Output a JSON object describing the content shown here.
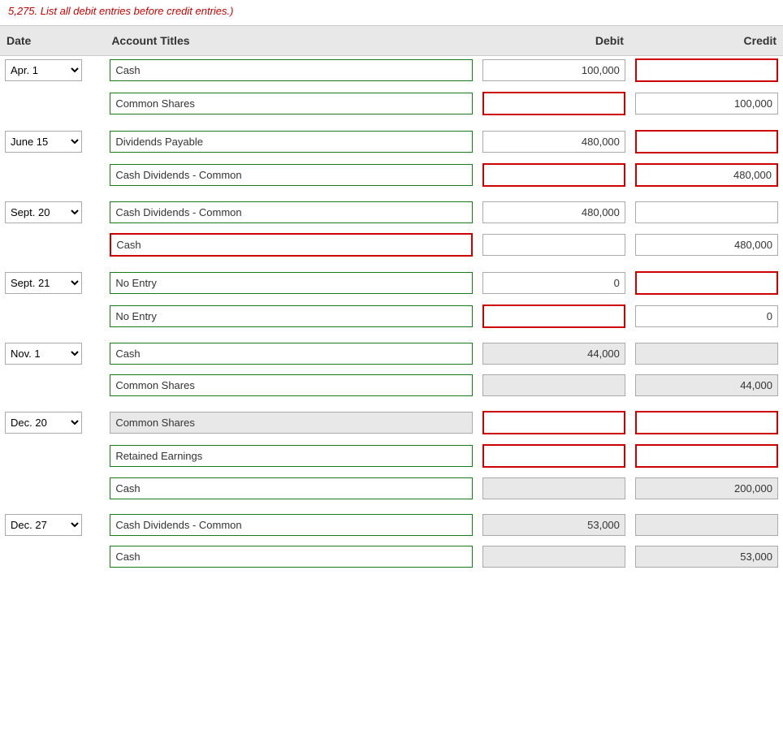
{
  "topNote": "5,275. List all debit entries before credit entries.)",
  "header": {
    "date": "Date",
    "accountTitles": "Account Titles",
    "debit": "Debit",
    "credit": "Credit"
  },
  "rows": [
    {
      "id": "row1",
      "date": "Apr. 1",
      "dateOptions": [
        "Apr. 1",
        "June 15",
        "Sept. 20",
        "Sept. 21",
        "Nov. 1",
        "Dec. 20",
        "Dec. 27"
      ],
      "entries": [
        {
          "account": "Cash",
          "accountStyle": "green-border",
          "debit": "100,000",
          "debitStyle": "normal",
          "credit": "",
          "creditStyle": "red-border"
        },
        {
          "account": "Common Shares",
          "accountStyle": "green-border",
          "debit": "",
          "debitStyle": "red-border",
          "credit": "100,000",
          "creditStyle": "normal"
        }
      ]
    },
    {
      "id": "row2",
      "date": "June 15",
      "dateOptions": [
        "Apr. 1",
        "June 15",
        "Sept. 20",
        "Sept. 21",
        "Nov. 1",
        "Dec. 20",
        "Dec. 27"
      ],
      "entries": [
        {
          "account": "Dividends Payable",
          "accountStyle": "green-border",
          "debit": "480,000",
          "debitStyle": "normal",
          "credit": "",
          "creditStyle": "red-border"
        },
        {
          "account": "Cash Dividends - Common",
          "accountStyle": "green-border",
          "debit": "",
          "debitStyle": "red-border",
          "credit": "480,000",
          "creditStyle": "red-border"
        }
      ]
    },
    {
      "id": "row3",
      "date": "Sept. 20",
      "dateOptions": [
        "Apr. 1",
        "June 15",
        "Sept. 20",
        "Sept. 21",
        "Nov. 1",
        "Dec. 20",
        "Dec. 27"
      ],
      "entries": [
        {
          "account": "Cash Dividends - Common",
          "accountStyle": "green-border",
          "debit": "480,000",
          "debitStyle": "normal",
          "credit": "",
          "creditStyle": "normal"
        },
        {
          "account": "Cash",
          "accountStyle": "red-border",
          "debit": "",
          "debitStyle": "normal",
          "credit": "480,000",
          "creditStyle": "normal"
        }
      ]
    },
    {
      "id": "row4",
      "date": "Sept. 21",
      "dateOptions": [
        "Apr. 1",
        "June 15",
        "Sept. 20",
        "Sept. 21",
        "Nov. 1",
        "Dec. 20",
        "Dec. 27"
      ],
      "entries": [
        {
          "account": "No Entry",
          "accountStyle": "green-border",
          "debit": "0",
          "debitStyle": "normal",
          "credit": "",
          "creditStyle": "red-border"
        },
        {
          "account": "No Entry",
          "accountStyle": "green-border",
          "debit": "",
          "debitStyle": "red-border",
          "credit": "0",
          "creditStyle": "normal"
        }
      ]
    },
    {
      "id": "row5",
      "date": "Nov. 1",
      "dateOptions": [
        "Apr. 1",
        "June 15",
        "Sept. 20",
        "Sept. 21",
        "Nov. 1",
        "Dec. 20",
        "Dec. 27"
      ],
      "entries": [
        {
          "account": "Cash",
          "accountStyle": "green-border",
          "debit": "44,000",
          "debitStyle": "green-fill",
          "credit": "",
          "creditStyle": "green-fill"
        },
        {
          "account": "Common Shares",
          "accountStyle": "green-border",
          "debit": "",
          "debitStyle": "green-fill",
          "credit": "44,000",
          "creditStyle": "green-fill"
        }
      ]
    },
    {
      "id": "row6",
      "date": "Dec. 20",
      "dateOptions": [
        "Apr. 1",
        "June 15",
        "Sept. 20",
        "Sept. 21",
        "Nov. 1",
        "Dec. 20",
        "Dec. 27"
      ],
      "entries": [
        {
          "account": "Common Shares",
          "accountStyle": "gray-bg",
          "debit": "",
          "debitStyle": "red-border",
          "credit": "",
          "creditStyle": "red-border"
        },
        {
          "account": "Retained Earnings",
          "accountStyle": "green-border",
          "debit": "",
          "debitStyle": "red-border",
          "credit": "",
          "creditStyle": "red-border"
        },
        {
          "account": "Cash",
          "accountStyle": "green-border",
          "debit": "",
          "debitStyle": "green-fill",
          "credit": "200,000",
          "creditStyle": "green-fill"
        }
      ]
    },
    {
      "id": "row7",
      "date": "Dec. 27",
      "dateOptions": [
        "Apr. 1",
        "June 15",
        "Sept. 20",
        "Sept. 21",
        "Nov. 1",
        "Dec. 20",
        "Dec. 27"
      ],
      "entries": [
        {
          "account": "Cash Dividends - Common",
          "accountStyle": "green-border",
          "debit": "53,000",
          "debitStyle": "green-fill",
          "credit": "",
          "creditStyle": "green-fill"
        },
        {
          "account": "Cash",
          "accountStyle": "green-border",
          "debit": "",
          "debitStyle": "green-fill",
          "credit": "53,000",
          "creditStyle": "green-fill"
        }
      ]
    }
  ]
}
